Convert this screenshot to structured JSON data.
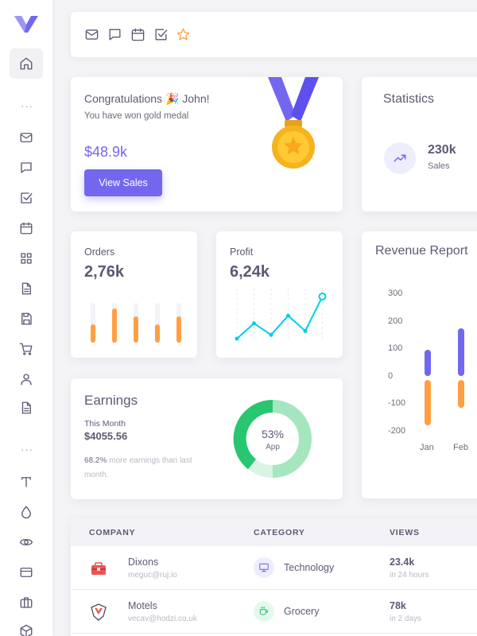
{
  "colors": {
    "primary": "#7367f0",
    "warning": "#ff9f43",
    "info": "#00cfe8",
    "success": "#28c76f",
    "danger": "#ea5455"
  },
  "sidebar": {
    "logo": "logo-icon",
    "items": [
      "home-icon",
      "more-dots",
      "mail-icon",
      "chat-icon",
      "todo-icon",
      "calendar-icon",
      "grid-icon",
      "invoice-icon",
      "save-icon",
      "cart-icon",
      "user-icon",
      "document-icon",
      "more-dots",
      "typography-icon",
      "droplet-icon",
      "eye-icon",
      "card-icon",
      "briefcase-icon",
      "box-icon"
    ],
    "dots": "···"
  },
  "topbar": {
    "icons": [
      "mail-icon",
      "chat-icon",
      "calendar-icon",
      "todo-icon",
      "star-icon"
    ]
  },
  "congrats": {
    "title": "Congratulations 🎉 John!",
    "subtitle": "You have won gold medal",
    "amount": "$48.9k",
    "button": "View Sales"
  },
  "statistics": {
    "title": "Statistics",
    "value": "230k",
    "label": "Sales"
  },
  "orders": {
    "label": "Orders",
    "value": "2,76k",
    "bars": [
      0.45,
      0.85,
      0.65,
      0.45,
      0.65
    ]
  },
  "profit": {
    "label": "Profit",
    "value": "6,24k",
    "points": [
      0,
      20,
      5,
      30,
      10,
      55
    ]
  },
  "revenue": {
    "title": "Revenue Report",
    "ticks": [
      "300",
      "200",
      "100",
      "0",
      "-100",
      "-200"
    ],
    "months": [
      "Jan",
      "Feb"
    ],
    "earning": [
      95,
      175
    ],
    "expense": [
      -165,
      -100
    ]
  },
  "earnings": {
    "title": "Earnings",
    "period": "This Month",
    "value": "$4055.56",
    "note_pct": "68.2%",
    "note_text": " more earnings than last month.",
    "donut_pct": "53%",
    "donut_label": "App"
  },
  "table": {
    "headers": [
      "COMPANY",
      "CATEGORY",
      "VIEWS"
    ],
    "rows": [
      {
        "company": "Dixons",
        "email": "meguc@ruj.io",
        "category": "Technology",
        "views": "23.4k",
        "views_sub": "in 24 hours"
      },
      {
        "company": "Motels",
        "email": "vecav@hodzi.co.uk",
        "category": "Grocery",
        "views": "78k",
        "views_sub": "in 2 days"
      }
    ]
  }
}
